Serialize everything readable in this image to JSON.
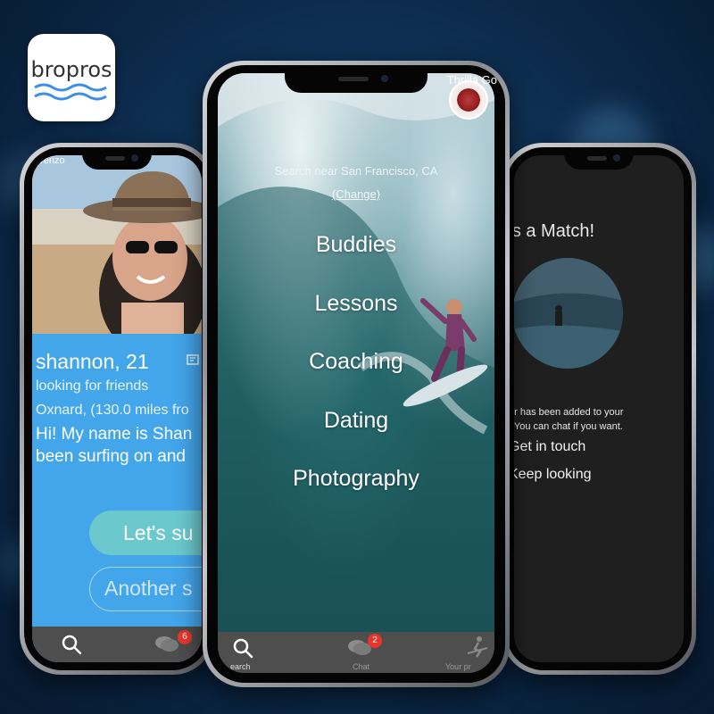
{
  "brand": {
    "logo_text": "bropros"
  },
  "left_phone": {
    "carrier": "Verizo",
    "profile": {
      "name": "shannon, 21",
      "looking_for": "looking for friends",
      "location": "Oxnard,  (130.0 miles fro",
      "bio_line1": "Hi! My name is Shan",
      "bio_line2": "been surfing on and"
    },
    "buttons": {
      "surf": "Let's su",
      "another": "Another s"
    },
    "tabbar": {
      "chat_badge": "6"
    }
  },
  "center_phone": {
    "user_label": "Thrilla Go",
    "search_near": "Search near San Francisco, CA",
    "change_link": "(Change)",
    "menu": [
      "Buddies",
      "Lessons",
      "Coaching",
      "Dating",
      "Photography"
    ],
    "tabbar": {
      "search_label": "earch",
      "chat_label": "Chat",
      "chat_badge": "2",
      "profile_label": "Your pr"
    }
  },
  "right_phone": {
    "title": "'s a Match!",
    "message_line1": "er has been added to your",
    "message_line2": ". You can chat if you want.",
    "get_in_touch": "Get in touch",
    "keep_looking": "Keep looking"
  },
  "colors": {
    "left_screen_bg": "#43a5ea",
    "surf_button": "#6bc9cd",
    "tabbar_bg": "#4e4e4e",
    "badge": "#e8352c",
    "match_bg": "#1f1f1f",
    "logo_wave": "#3a8ee6"
  },
  "icons": [
    "search-icon",
    "chat-icon",
    "surfer-icon",
    "flag-icon"
  ]
}
